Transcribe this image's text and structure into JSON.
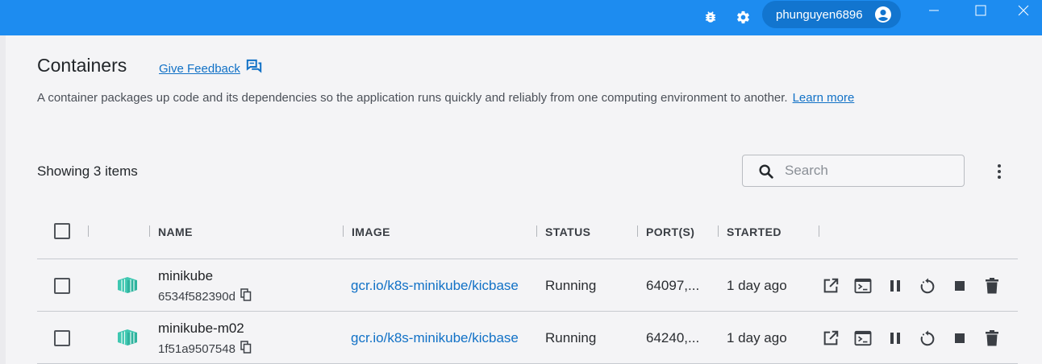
{
  "titlebar": {
    "bg": "#1d8cf0",
    "username": "phunguyen6896",
    "icons": [
      "bug-icon",
      "settings-icon",
      "account-icon",
      "minimize-icon",
      "maximize-icon",
      "close-icon"
    ]
  },
  "header": {
    "title": "Containers",
    "feedback_label": "Give Feedback",
    "description": "A container packages up code and its dependencies so the application runs quickly and reliably from one computing environment to another.",
    "learn_more": "Learn more"
  },
  "toolbar": {
    "showing": "Showing 3 items",
    "search_placeholder": "Search"
  },
  "table": {
    "columns": [
      "NAME",
      "IMAGE",
      "STATUS",
      "PORT(S)",
      "STARTED"
    ],
    "rows": [
      {
        "name": "minikube",
        "id": "6534f582390d",
        "image": "gcr.io/k8s-minikube/kicbase",
        "status": "Running",
        "ports": "64097,...",
        "started": "1 day ago"
      },
      {
        "name": "minikube-m02",
        "id": "1f51a9507548",
        "image": "gcr.io/k8s-minikube/kicbase",
        "status": "Running",
        "ports": "64240,...",
        "started": "1 day ago"
      }
    ],
    "row_actions": [
      "open-in-browser-icon",
      "cli-icon",
      "pause-icon",
      "restart-icon",
      "stop-icon",
      "delete-icon"
    ]
  },
  "colors": {
    "accent": "#1d8cf0",
    "link": "#1171c6",
    "container_icon": "#3fc7b1"
  }
}
